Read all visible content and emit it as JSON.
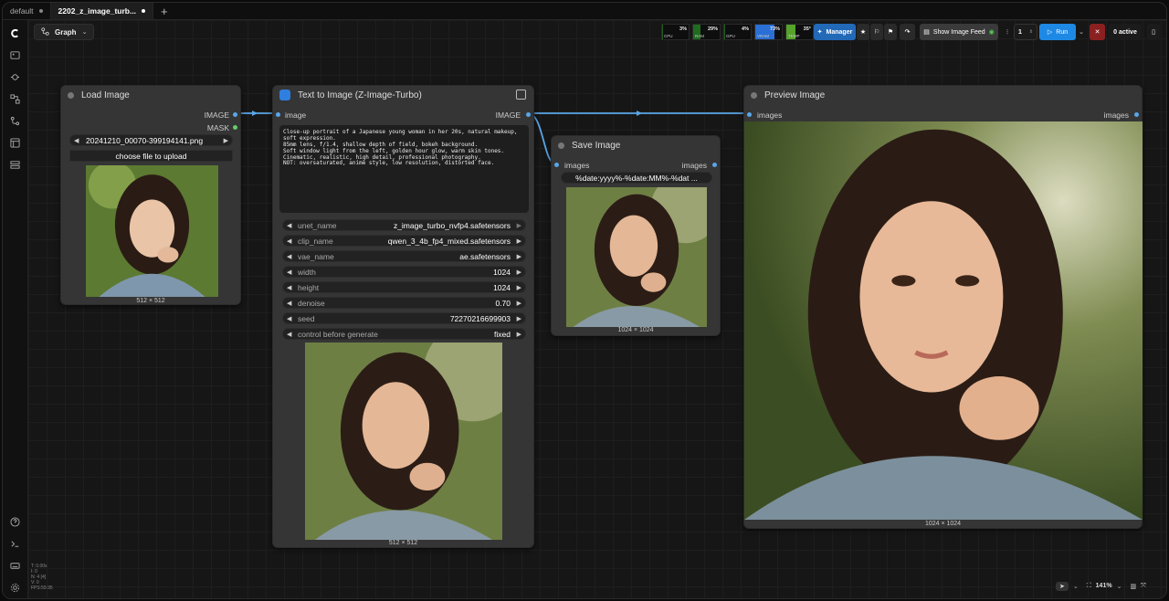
{
  "tabs": [
    {
      "label": "default",
      "active": false
    },
    {
      "label": "2202_z_image_turb...",
      "active": true
    }
  ],
  "toolbar": {
    "graph_label": "Graph",
    "stats": [
      {
        "label": "CPU",
        "value": "3%",
        "color": "#1f5f1f"
      },
      {
        "label": "RAM",
        "value": "29%",
        "color": "#1f6b1f"
      },
      {
        "label": "GPU",
        "value": "4%",
        "color": "#1f5f1f"
      },
      {
        "label": "VRAM",
        "value": "73%",
        "color": "#2a6fd6"
      },
      {
        "label": "TEMP",
        "value": "35°",
        "color": "#55a32a"
      }
    ],
    "manager_label": "Manager",
    "show_image_feed_label": "Show Image Feed",
    "queue_count": "1",
    "run_label": "Run",
    "active_label": "0 active",
    "accent": "#1e88e5"
  },
  "nodes": {
    "load_image": {
      "title": "Load Image",
      "outputs": [
        "IMAGE",
        "MASK"
      ],
      "filename": "20241210_00070-399194141.png",
      "upload_label": "choose file to upload",
      "size": "512 × 512"
    },
    "text_to_image": {
      "title": "Text to Image (Z-Image-Turbo)",
      "input": "image",
      "output": "IMAGE",
      "prompt": "Close-up portrait of a Japanese young woman in her 20s, natural makeup,\nsoft expression.\n85mm lens, f/1.4, shallow depth of field, bokeh background.\nSoft window light from the left, golden hour glow, warm skin tones.\nCinematic, realistic, high detail, professional photography.\nNOT: oversaturated, anime style, low resolution, distorted face.",
      "widgets": [
        {
          "label": "unet_name",
          "value": "z_image_turbo_nvfp4.safetensors"
        },
        {
          "label": "clip_name",
          "value": "qwen_3_4b_fp4_mixed.safetensors"
        },
        {
          "label": "vae_name",
          "value": "ae.safetensors"
        },
        {
          "label": "width",
          "value": "1024"
        },
        {
          "label": "height",
          "value": "1024"
        },
        {
          "label": "denoise",
          "value": "0.70"
        },
        {
          "label": "seed",
          "value": "72270216699903"
        },
        {
          "label": "control before generate",
          "value": "fixed"
        }
      ],
      "size": "512 × 512"
    },
    "save_image": {
      "title": "Save Image",
      "input": "images",
      "output": "images",
      "filename_prefix": "%date:yyyy%-%date:MM%-%dat ...",
      "size": "1024 × 1024"
    },
    "preview_image": {
      "title": "Preview Image",
      "input": "images",
      "output": "images",
      "size": "1024 × 1024"
    }
  },
  "stats_overlay": [
    "T: 0.00s",
    "I: 0",
    "N: 4 [4]",
    "V: 0",
    "FPS:59.95"
  ],
  "zoom": "141%"
}
